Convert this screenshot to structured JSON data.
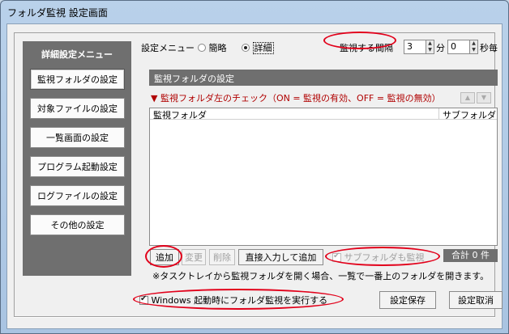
{
  "window": {
    "title": "フォルダ監視 設定画面"
  },
  "sidebar": {
    "title": "詳細設定メニュー",
    "items": [
      {
        "label": "監視フォルダの設定",
        "active": true
      },
      {
        "label": "対象ファイルの設定"
      },
      {
        "label": "一覧画面の設定"
      },
      {
        "label": "プログラム起動設定"
      },
      {
        "label": "ログファイルの設定"
      },
      {
        "label": "その他の設定"
      }
    ]
  },
  "topbar": {
    "menu_label": "設定メニュー",
    "mode_simple": "簡略",
    "mode_detail": "詳細",
    "selected_mode": "詳細",
    "interval_label": "監視する間隔",
    "minutes_value": "3",
    "minutes_unit": "分",
    "seconds_value": "0",
    "seconds_unit": "秒毎"
  },
  "section": {
    "title": "監視フォルダの設定",
    "notice": "▼ 監視フォルダ左のチェック（ON = 監視の有効、OFF = 監視の無効）"
  },
  "list": {
    "columns": [
      "監視フォルダ",
      "サブフォルダ"
    ],
    "rows": []
  },
  "actions": {
    "add": "追加",
    "change": "変更",
    "delete": "削除",
    "direct_add": "直接入力して追加",
    "subfolder_watch": "サブフォルダも監視",
    "total": "合計 0 件"
  },
  "note": "※タスクトレイから監視フォルダを開く場合、一覧で一番上のフォルダを開きます。",
  "footer": {
    "startup_label": "Windows 起動時にフォルダ監視を実行する",
    "startup_checked": true,
    "save": "設定保存",
    "cancel": "設定取消"
  },
  "colors": {
    "highlight": "#e2001a",
    "panel_gray": "#6f6f6f",
    "notice_red": "#b00000"
  }
}
